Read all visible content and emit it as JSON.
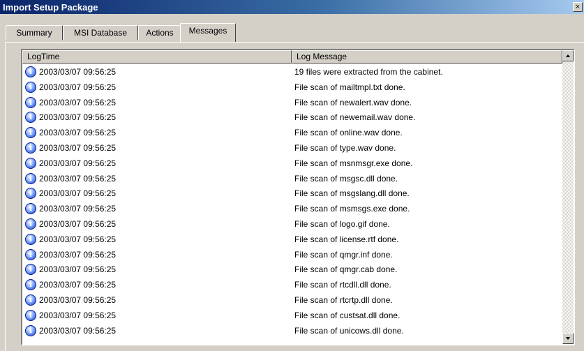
{
  "window": {
    "title": "Import Setup Package",
    "close_label": "×"
  },
  "tabs": [
    {
      "label": "Summary"
    },
    {
      "label": "MSI Database"
    },
    {
      "label": "Actions"
    },
    {
      "label": "Messages",
      "active": true
    }
  ],
  "list": {
    "columns": [
      {
        "label": "LogTime"
      },
      {
        "label": "Log Message"
      }
    ],
    "row_icon": "info-icon",
    "rows": [
      {
        "time": "2003/03/07 09:56:25",
        "message": "19 files were extracted from the cabinet."
      },
      {
        "time": "2003/03/07 09:56:25",
        "message": "File scan of mailtmpl.txt done."
      },
      {
        "time": "2003/03/07 09:56:25",
        "message": "File scan of newalert.wav done."
      },
      {
        "time": "2003/03/07 09:56:25",
        "message": "File scan of newemail.wav done."
      },
      {
        "time": "2003/03/07 09:56:25",
        "message": "File scan of online.wav done."
      },
      {
        "time": "2003/03/07 09:56:25",
        "message": "File scan of type.wav done."
      },
      {
        "time": "2003/03/07 09:56:25",
        "message": "File scan of msnmsgr.exe done."
      },
      {
        "time": "2003/03/07 09:56:25",
        "message": "File scan of msgsc.dll done."
      },
      {
        "time": "2003/03/07 09:56:25",
        "message": "File scan of msgslang.dll done."
      },
      {
        "time": "2003/03/07 09:56:25",
        "message": "File scan of msmsgs.exe done."
      },
      {
        "time": "2003/03/07 09:56:25",
        "message": "File scan of logo.gif done."
      },
      {
        "time": "2003/03/07 09:56:25",
        "message": "File scan of license.rtf done."
      },
      {
        "time": "2003/03/07 09:56:25",
        "message": "File scan of qmgr.inf done."
      },
      {
        "time": "2003/03/07 09:56:25",
        "message": "File scan of qmgr.cab done."
      },
      {
        "time": "2003/03/07 09:56:25",
        "message": "File scan of rtcdll.dll done."
      },
      {
        "time": "2003/03/07 09:56:25",
        "message": "File scan of rtcrtp.dll done."
      },
      {
        "time": "2003/03/07 09:56:25",
        "message": "File scan of custsat.dll done."
      },
      {
        "time": "2003/03/07 09:56:25",
        "message": "File scan of unicows.dll done."
      }
    ]
  }
}
